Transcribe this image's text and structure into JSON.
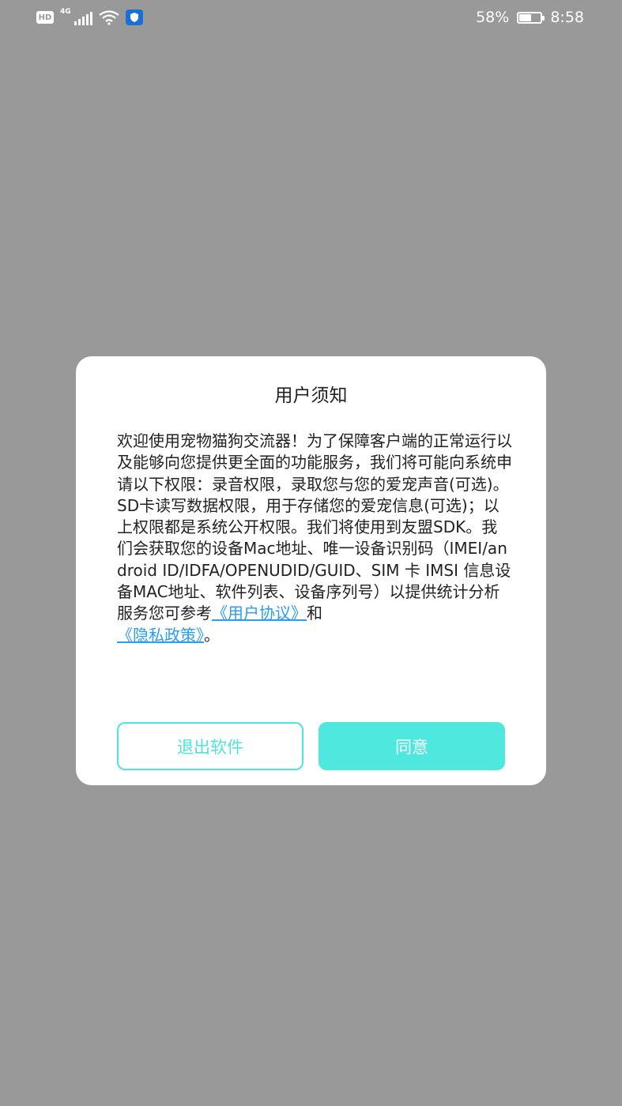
{
  "status_bar": {
    "hd_label": "HD",
    "network_type": "4G",
    "battery_percent": "58%",
    "battery_level": 0.58,
    "time": "8:58",
    "icons": [
      "hd-icon",
      "signal-icon",
      "wifi-icon",
      "shield-app-icon",
      "battery-icon"
    ]
  },
  "dialog": {
    "title": "用户须知",
    "body_text": "欢迎使用宠物猫狗交流器！为了保障客户端的正常运行以及能够向您提供更全面的功能服务，我们将可能向系统申请以下权限：录音权限，录取您与您的爱宠声音(可选)。SD卡读写数据权限，用于存储您的爱宠信息(可选)；以上权限都是系统公开权限。我们将使用到友盟SDK。我们会获取您的设备Mac地址、唯一设备识别码（IMEI/android ID/IDFA/OPENUDID/GUID、SIM 卡 IMSI 信息设备MAC地址、软件列表、设备序列号）以提供统计分析服务您可参考",
    "user_agreement_link": "《用户协议》",
    "connector": "和",
    "privacy_policy_link": "《隐私政策》",
    "ending": "。",
    "exit_button": "退出软件",
    "agree_button": "同意"
  },
  "colors": {
    "backdrop": "#999999",
    "accent": "#4fe8de",
    "link": "#2a9df4"
  }
}
